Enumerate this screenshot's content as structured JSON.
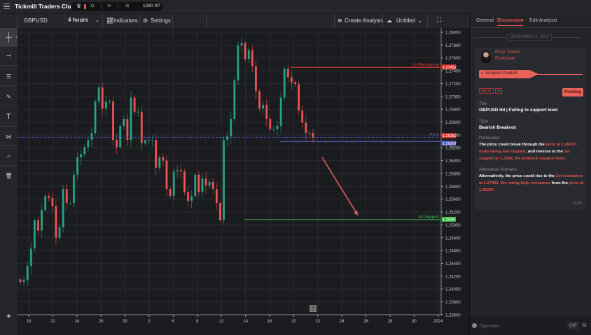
{
  "app": {
    "title": "Tickmill Traders Club",
    "badges": [
      "13",
      "14",
      "15"
    ],
    "xp": "1280 XP"
  },
  "toolbar": {
    "symbol": "GBPUSD",
    "interval": "4 hours",
    "indicators": "Indicators",
    "settings": "Settings",
    "create_analysis": "Create Analysis",
    "layout_name": "Untitled"
  },
  "panel": {
    "tabs": [
      {
        "label": "General"
      },
      {
        "label": "Discussion",
        "active": true
      },
      {
        "label": "Edit Analysis"
      }
    ],
    "close_tab": "×",
    "date_separator": "DECEMBER 21, 2023",
    "author_role": "Prop Trader",
    "author_name": "Emilysaw",
    "event": "Analysis Created",
    "tags": [
      "GBPUSD",
      "H4"
    ],
    "status": "Pending",
    "title_label": "Title",
    "title_value": "GBPUSD H4 | Falling to support level",
    "type_label": "Type",
    "type_value": "Bearish Breakout",
    "pref_label": "Preference:",
    "pref_text": [
      {
        "t": "The price could break through the "
      },
      {
        "t": "pivot at 1.26297, multi-swing low support",
        "h": true
      },
      {
        "t": ", and reverse to the "
      },
      {
        "t": "1st support at 1.2508, the pullback support level.",
        "h": true
      }
    ],
    "alt_label": "Alternative Scenario:",
    "alt_text": [
      {
        "t": "Alternatively, the price could rise to the "
      },
      {
        "t": "1st resistance at 1.27452, the swing-high resistance",
        "h": true
      },
      {
        "t": " from the "
      },
      {
        "t": "pivot at 1.26297",
        "h": true
      }
    ],
    "time": "14:22",
    "input_placeholder": "Type here...",
    "gif": "GIF"
  },
  "colors": {
    "up": "#26a387",
    "down": "#ef5350",
    "accent": "#e8625a",
    "resistance": "#e53935",
    "support": "#3fbf4f",
    "pivot": "#5b5fc7"
  },
  "chart_data": {
    "type": "candlestick",
    "symbol": "GBPUSD",
    "interval": "4 hours",
    "ylim": [
      1.236,
      1.28
    ],
    "y_ticks": [
      "1.28000",
      "1.27800",
      "1.27600",
      "1.27400",
      "1.27200",
      "1.27000",
      "1.26800",
      "1.26600",
      "1.26400",
      "1.26200",
      "1.26000",
      "1.25800",
      "1.25600",
      "1.25400",
      "1.25200",
      "1.25000",
      "1.24800",
      "1.24600",
      "1.24400",
      "1.24200",
      "1.24000",
      "1.23800",
      "1.23600"
    ],
    "x_ticks": [
      "18",
      "22",
      "24",
      "28",
      "30",
      "2",
      "6",
      "8",
      "12",
      "14",
      "16",
      "20",
      "22",
      "24",
      "26",
      "28",
      "30",
      "2024"
    ],
    "closes": [
      1.2411,
      1.2414,
      1.2436,
      1.2463,
      1.2507,
      1.2491,
      1.2523,
      1.2545,
      1.2542,
      1.2529,
      1.248,
      1.2496,
      1.2556,
      1.2534,
      1.2534,
      1.2578,
      1.2605,
      1.261,
      1.2621,
      1.2632,
      1.2643,
      1.2692,
      1.2714,
      1.2681,
      1.2692,
      1.2692,
      1.2632,
      1.2621,
      1.2654,
      1.2665,
      1.2632,
      1.2698,
      1.2676,
      1.2676,
      1.2627,
      1.2632,
      1.2632,
      1.2632,
      1.2589,
      1.2605,
      1.26,
      1.2556,
      1.2545,
      1.2583,
      1.2585,
      1.2583,
      1.2551,
      1.2537,
      1.2545,
      1.2578,
      1.2551,
      1.2572,
      1.2561,
      1.2567,
      1.2556,
      1.2534,
      1.2507,
      1.2632,
      1.2638,
      1.2665,
      1.2725,
      1.2779,
      1.2783,
      1.2758,
      1.2772,
      1.2747,
      1.2708,
      1.2681,
      1.2687,
      1.2665,
      1.2649,
      1.2649,
      1.2654,
      1.2698,
      1.2743,
      1.273,
      1.2722,
      1.2719,
      1.2678,
      1.2659,
      1.2643,
      1.2643,
      1.2636
    ],
    "levels": [
      {
        "name": "1st Resistance",
        "price": 1.27452,
        "tag": "1.27452",
        "color": "#e53935"
      },
      {
        "name": "Pivot",
        "price": 1.26362,
        "tag": "1.26362",
        "color": "#5b5fc7",
        "dashed": true
      },
      {
        "name": "",
        "price": 1.26297,
        "tag": "1.26297",
        "color": "#5b5fc7"
      },
      {
        "name": "1st Support",
        "price": 1.2508,
        "tag": "1.2508",
        "color": "#3fbf4f"
      }
    ],
    "arrow": {
      "from": 1.2605,
      "to": 1.2515,
      "direction": "down"
    }
  }
}
